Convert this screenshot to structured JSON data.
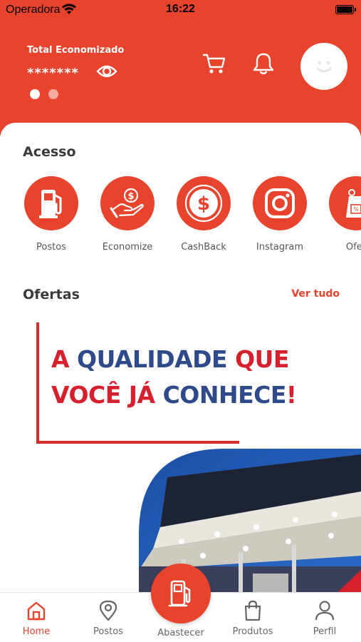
{
  "status_bar": {
    "carrier": "Operadora",
    "time": "16:22"
  },
  "header": {
    "savings_label": "Total Economizado",
    "savings_value": "*******",
    "carousel_pages": 2,
    "icons": [
      "eye-icon",
      "cart-icon",
      "bell-icon",
      "avatar-smiley-icon"
    ]
  },
  "acesso": {
    "title": "Acesso",
    "items": [
      {
        "label": "Postos",
        "icon": "fuel-pump-icon"
      },
      {
        "label": "Economize",
        "icon": "money-hand-icon"
      },
      {
        "label": "CashBack",
        "icon": "dollar-coin-icon"
      },
      {
        "label": "Instagram",
        "icon": "instagram-icon"
      },
      {
        "label": "Ofer",
        "icon": "price-tag-icon"
      }
    ]
  },
  "ofertas": {
    "title": "Ofertas",
    "see_all": "Ver tudo",
    "banner": {
      "line1_a": "A ",
      "line1_b": "QUALIDADE ",
      "line1_c": "QUE",
      "line2_a": "VOCÊ JÁ ",
      "line2_b": "CONHECE",
      "line2_c": "!"
    }
  },
  "tabbar": {
    "items": [
      {
        "label": "Home",
        "icon": "home-icon",
        "active": true
      },
      {
        "label": "Postos",
        "icon": "location-pin-icon",
        "active": false
      },
      {
        "label": "Abastecer",
        "icon": "fuel-pump-icon",
        "active": false
      },
      {
        "label": "Produtos",
        "icon": "shopping-bag-icon",
        "active": false
      },
      {
        "label": "Perfil",
        "icon": "user-icon",
        "active": false
      }
    ]
  },
  "colors": {
    "primary": "#e8432d",
    "banner_red": "#d7202e",
    "banner_blue": "#2f4a8a"
  }
}
